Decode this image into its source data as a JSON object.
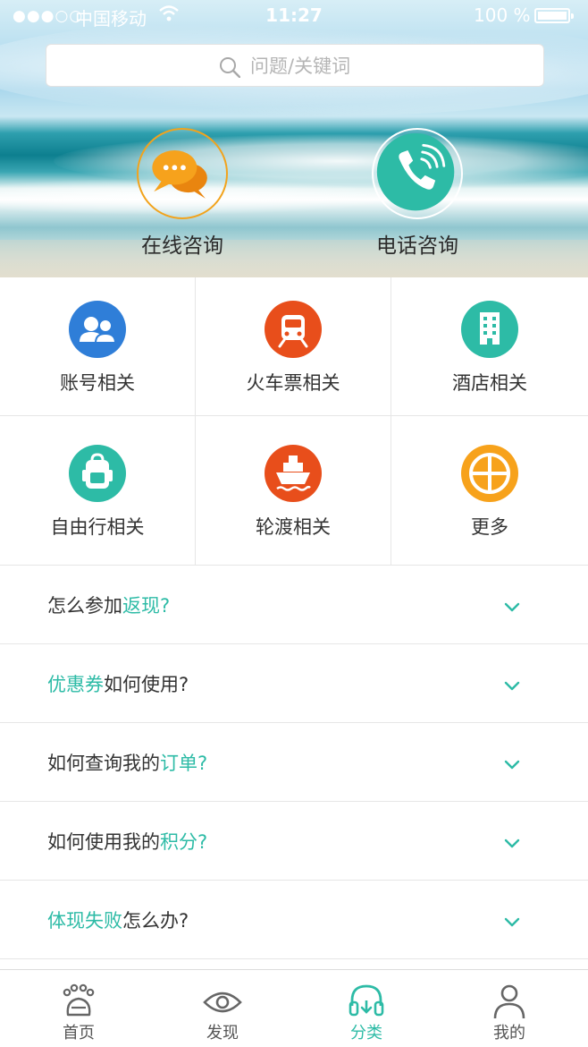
{
  "status_bar": {
    "signal": "●●●○○",
    "carrier": "中国移动",
    "time": "11:27",
    "battery": "100 %"
  },
  "search": {
    "placeholder": "问题/关键词"
  },
  "consult": {
    "online_label": "在线咨询",
    "phone_label": "电话咨询"
  },
  "categories": [
    {
      "label": "账号相关",
      "icon": "account-icon",
      "color": "#2f7ed8"
    },
    {
      "label": "火车票相关",
      "icon": "train-icon",
      "color": "#e84e1b"
    },
    {
      "label": "酒店相关",
      "icon": "hotel-icon",
      "color": "#2dbba6"
    },
    {
      "label": "自由行相关",
      "icon": "backpack-icon",
      "color": "#2dbba6"
    },
    {
      "label": "轮渡相关",
      "icon": "ship-icon",
      "color": "#e84e1b"
    },
    {
      "label": "更多",
      "icon": "more-icon",
      "color": "#f7a21b"
    }
  ],
  "faq": [
    {
      "pre": "怎么参加",
      "hl": "返现?",
      "post": ""
    },
    {
      "pre": "",
      "hl": "优惠券",
      "post": "如何使用?"
    },
    {
      "pre": "如何查询我的",
      "hl": "订单?",
      "post": ""
    },
    {
      "pre": "如何使用我的",
      "hl": "积分?",
      "post": ""
    },
    {
      "pre": "",
      "hl": "体现失败",
      "post": "怎么办?"
    }
  ],
  "tabs": [
    {
      "label": "首页",
      "icon": "home-icon",
      "active": false
    },
    {
      "label": "发现",
      "icon": "eye-icon",
      "active": false
    },
    {
      "label": "分类",
      "icon": "headset-icon",
      "active": true
    },
    {
      "label": "我的",
      "icon": "user-icon",
      "active": false
    }
  ],
  "colors": {
    "accent": "#2dbba6",
    "online_ring": "#f2a31c",
    "text": "#333333"
  }
}
